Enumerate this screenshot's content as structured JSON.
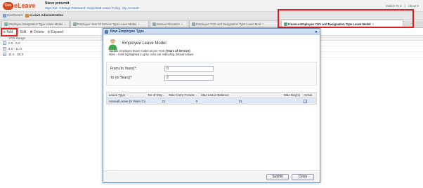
{
  "header": {
    "logo_mark": "Dev",
    "app_name": "eLeave",
    "user_name": "Steve prescott",
    "links": [
      "Sign Out",
      "Change Password",
      "Download Leave Policy",
      "My Account"
    ],
    "right_links": [
      "Switch To",
      "About"
    ]
  },
  "breadcrumb": {
    "items": [
      "Dashboard",
      "eLeave Administration"
    ]
  },
  "tabs": [
    {
      "label": "Employee Designation Type Leave Model",
      "selected": false
    },
    {
      "label": "Employee Year Of Service Type Leave Model",
      "selected": false
    },
    {
      "label": "Manual Allocation",
      "selected": false
    },
    {
      "label": "Employee YOS and Designation Type Leave Mod",
      "selected": false
    },
    {
      "label": "Finance-Employee YOS and Designation Type Leave Model",
      "selected": true
    }
  ],
  "toolbar": {
    "add_label": "Add",
    "edit_label": "Edit",
    "delete_label": "Delete",
    "expand_label": "Expand"
  },
  "grid": {
    "column_header": "YOS Range",
    "rows": [
      "0.0 - 5.0",
      "6.0 - 11.0",
      "11.0 - 55.0"
    ]
  },
  "modal": {
    "title": "New Employee Type",
    "heading": "Employee Leave Model",
    "help_line1_pre": "Update employee leave model as per YOS ",
    "help_line1_bold": "(Years of Service)",
    "help_line2": "Note - Cells highlighted in grey color are indicating default values",
    "from_label": "From (In Years)*:",
    "from_value": "0",
    "to_label": "To (In Years)*:",
    "to_value": "2",
    "table": {
      "columns": [
        "Leave Type",
        "No of Day...",
        "Max Carry Forwar...",
        "Max Leave Balance",
        "Max Day(s)",
        "Active"
      ],
      "rows": [
        {
          "leave_type": "Annual Leave (5 Years Co",
          "days": "21",
          "carry_forward": "0",
          "leave_balance": "21",
          "max_days": "",
          "active": true
        }
      ]
    },
    "submit_label": "Submit",
    "close_label": "Close"
  },
  "colors": {
    "brand": "#d8481b",
    "highlight": "#e02020",
    "window_title": "#15428b"
  }
}
